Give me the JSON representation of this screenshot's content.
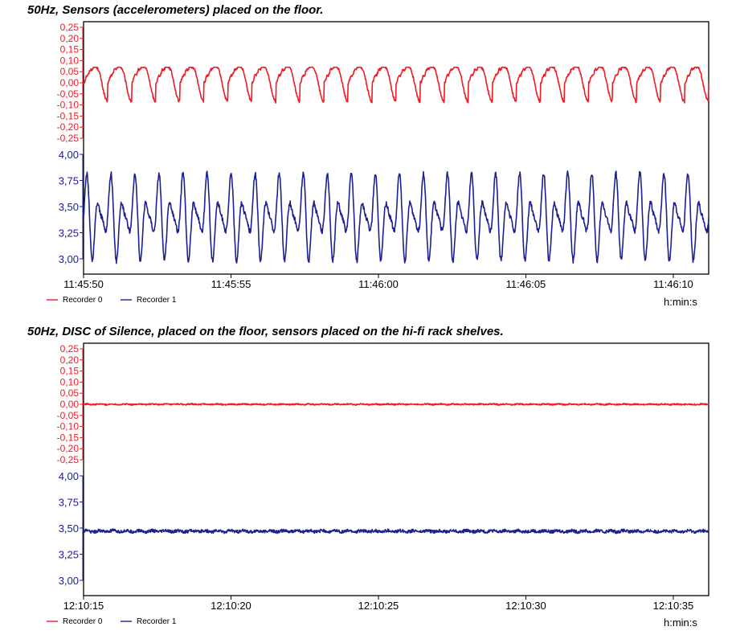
{
  "colors": {
    "recorder0": "#ee1c24",
    "recorder1": "#1b2191",
    "frame": "#000000"
  },
  "chart_data": [
    {
      "type": "line",
      "title": "50Hz, Sensors (accelerometers) placed on the floor.",
      "xunit": "h:min:s",
      "x_ticks": [
        "11:45:50",
        "11:45:55",
        "11:46:00",
        "11:46:05",
        "11:46:10"
      ],
      "x_range_seconds": [
        0,
        21.2
      ],
      "legend": [
        "Recorder 0",
        "Recorder 1"
      ],
      "legend_position": "bottom-left",
      "upper_axis": {
        "ticks": [
          "0,25",
          "0,20",
          "0,15",
          "0,10",
          "0,05",
          "0,00",
          "-0,05",
          "-0,10",
          "-0,15",
          "-0,20",
          "-0,25"
        ],
        "range": [
          -0.25,
          0.25
        ]
      },
      "lower_axis": {
        "ticks": [
          "4,00",
          "3,75",
          "3,50",
          "3,25",
          "3,00"
        ],
        "range": [
          3.0,
          4.0
        ]
      },
      "series": [
        {
          "name": "Recorder 0",
          "axis": "upper",
          "pattern": "periodic",
          "cycles": 26,
          "max": 0.07,
          "min": -0.1,
          "mean": -0.01
        },
        {
          "name": "Recorder 1",
          "axis": "lower",
          "pattern": "periodic",
          "cycles": 26,
          "max": 3.93,
          "min": 2.93,
          "mean": 3.4
        }
      ]
    },
    {
      "type": "line",
      "title": "50Hz, DISC of Silence, placed on the floor, sensors placed on the hi-fi rack shelves.",
      "xunit": "h:min:s",
      "x_ticks": [
        "12:10:15",
        "12:10:20",
        "12:10:25",
        "12:10:30",
        "12:10:35"
      ],
      "x_range_seconds": [
        0,
        21.2
      ],
      "legend": [
        "Recorder 0",
        "Recorder 1"
      ],
      "legend_position": "bottom-left",
      "upper_axis": {
        "ticks": [
          "0,25",
          "0,20",
          "0,15",
          "0,10",
          "0,05",
          "0,00",
          "-0,05",
          "-0,10",
          "-0,15",
          "-0,20",
          "-0,25"
        ],
        "range": [
          -0.25,
          0.25
        ]
      },
      "lower_axis": {
        "ticks": [
          "4,00",
          "3,75",
          "3,50",
          "3,25",
          "3,00"
        ],
        "range": [
          3.0,
          4.0
        ]
      },
      "series": [
        {
          "name": "Recorder 0",
          "axis": "upper",
          "pattern": "flat",
          "mean": 0.0,
          "noise": 0.003
        },
        {
          "name": "Recorder 1",
          "axis": "lower",
          "pattern": "flat",
          "mean": 3.47,
          "noise": 0.015
        }
      ]
    }
  ]
}
